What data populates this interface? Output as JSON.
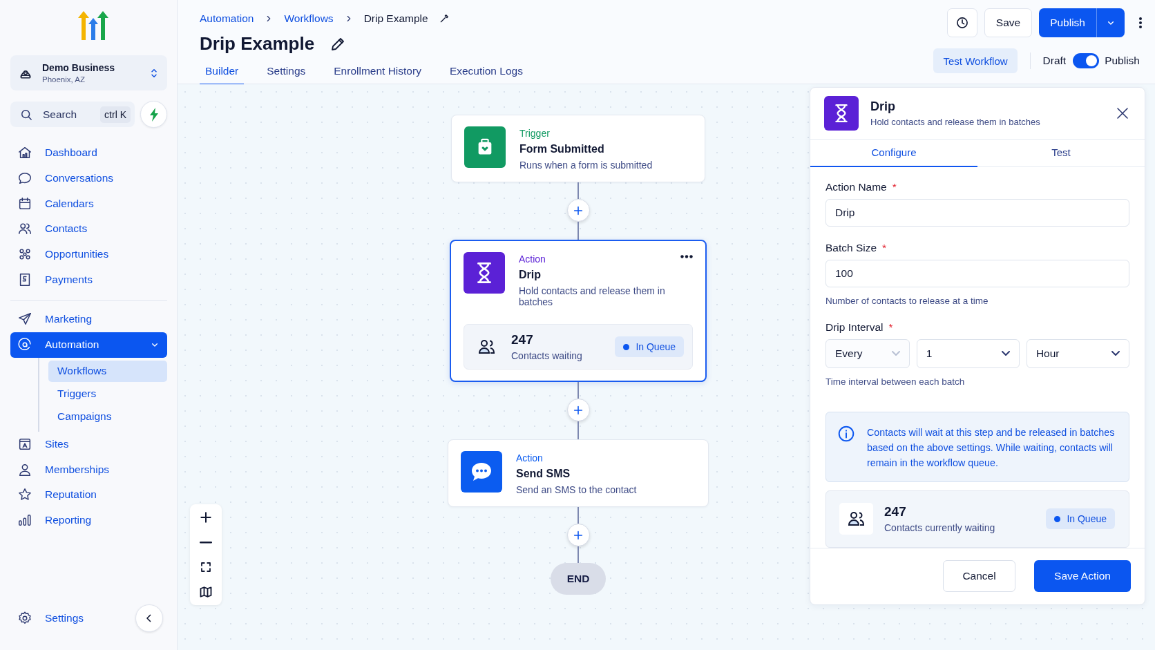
{
  "sidebar": {
    "account": {
      "name": "Demo Business",
      "location": "Phoenix, AZ"
    },
    "search": {
      "placeholder": "Search",
      "shortcut": "ctrl K"
    },
    "groups": [
      {
        "items": [
          {
            "label": "Dashboard",
            "selected": false
          },
          {
            "label": "Conversations",
            "selected": false
          },
          {
            "label": "Calendars",
            "selected": false
          },
          {
            "label": "Contacts",
            "selected": false
          },
          {
            "label": "Opportunities",
            "selected": false
          },
          {
            "label": "Payments",
            "selected": false
          }
        ]
      },
      {
        "items": [
          {
            "label": "Marketing",
            "selected": false
          },
          {
            "label": "Automation",
            "selected": true,
            "expanded": true,
            "children": [
              {
                "label": "Workflows",
                "selected": true
              },
              {
                "label": "Triggers",
                "selected": false
              },
              {
                "label": "Campaigns",
                "selected": false
              }
            ]
          },
          {
            "label": "Sites",
            "selected": false
          },
          {
            "label": "Memberships",
            "selected": false
          },
          {
            "label": "Reputation",
            "selected": false
          },
          {
            "label": "Reporting",
            "selected": false
          }
        ]
      }
    ],
    "footer": {
      "label": "Settings"
    }
  },
  "header": {
    "breadcrumbs": [
      "Automation",
      "Workflows",
      "Drip Example"
    ],
    "title": "Drip Example",
    "tabs": [
      {
        "label": "Builder",
        "selected": true
      },
      {
        "label": "Settings",
        "selected": false
      },
      {
        "label": "Enrollment History",
        "selected": false
      },
      {
        "label": "Execution Logs",
        "selected": false
      }
    ],
    "save_button": "Save",
    "publish_button": "Publish",
    "test_button": "Test Workflow",
    "toggle": {
      "off_label": "Draft",
      "on_label": "Publish",
      "on": true
    }
  },
  "canvas": {
    "nodes": [
      {
        "kind": "trigger",
        "category": "Trigger",
        "title": "Form Submitted",
        "description": "Runs when a form is submitted",
        "color": "#119a62",
        "selected": false
      },
      {
        "kind": "drip",
        "category": "Action",
        "title": "Drip",
        "description": "Hold contacts and release them in batches",
        "color": "#5b21d6",
        "selected": true,
        "stats": {
          "count": "247",
          "label": "Contacts waiting",
          "status": "In Queue"
        }
      },
      {
        "kind": "sms",
        "category": "Action",
        "title": "Send SMS",
        "description": "Send an SMS to the contact",
        "color": "#0b5cf0",
        "selected": false
      }
    ],
    "end_label": "END"
  },
  "panel": {
    "title": "Drip",
    "subtitle": "Hold contacts and release them in batches",
    "tabs": [
      {
        "label": "Configure",
        "selected": true
      },
      {
        "label": "Test",
        "selected": false
      }
    ],
    "fields": [
      {
        "kind": "text",
        "label": "Action Name",
        "required_mark": "*",
        "value": "Drip"
      },
      {
        "kind": "text",
        "label": "Batch Size",
        "required_mark": "*",
        "value": "100",
        "help": "Number of contacts to release at a time"
      },
      {
        "kind": "selects",
        "label": "Drip Interval",
        "required_mark": "*",
        "options": [
          {
            "value": "Every",
            "disabled": true
          },
          {
            "value": "1",
            "disabled": false
          },
          {
            "value": "Hour",
            "disabled": false
          }
        ],
        "help": "Time interval between each batch"
      }
    ],
    "info": "Contacts will wait at this step and be released in batches based on the above settings. While waiting, contacts will remain in the workflow queue.",
    "stats": {
      "count": "247",
      "label": "Contacts currently waiting",
      "status": "In Queue"
    },
    "cancel_button": "Cancel",
    "save_button": "Save Action"
  }
}
